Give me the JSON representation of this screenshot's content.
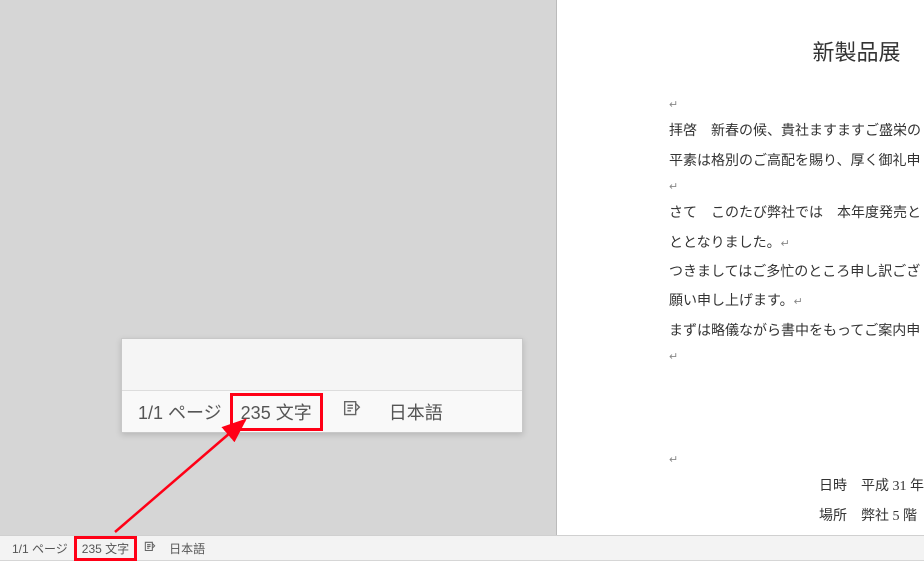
{
  "status_bar": {
    "page_info": "1/1 ページ",
    "word_count": "235 文字",
    "language": "日本語"
  },
  "callout": {
    "page_info": "1/1 ページ",
    "word_count": "235 文字",
    "language": "日本語"
  },
  "document": {
    "title": "新製品展",
    "line1": "拝啓　新春の候、貴社ますますご盛栄の",
    "line2": "平素は格別のご高配を賜り、厚く御礼申",
    "line3": "さて　このたび弊社では　本年度発売と",
    "line4": "ととなりました。",
    "line5": "つきましてはご多忙のところ申し訳ござ",
    "line6": "願い申し上げます。",
    "line7": "まずは略儀ながら書中をもってご案内申",
    "date_line": "日時　平成 31 年",
    "place_line": "場所　弊社 5 階",
    "return": "↵"
  },
  "icons": {
    "proofing": "proofing-icon"
  },
  "colors": {
    "highlight": "#ff0016"
  }
}
